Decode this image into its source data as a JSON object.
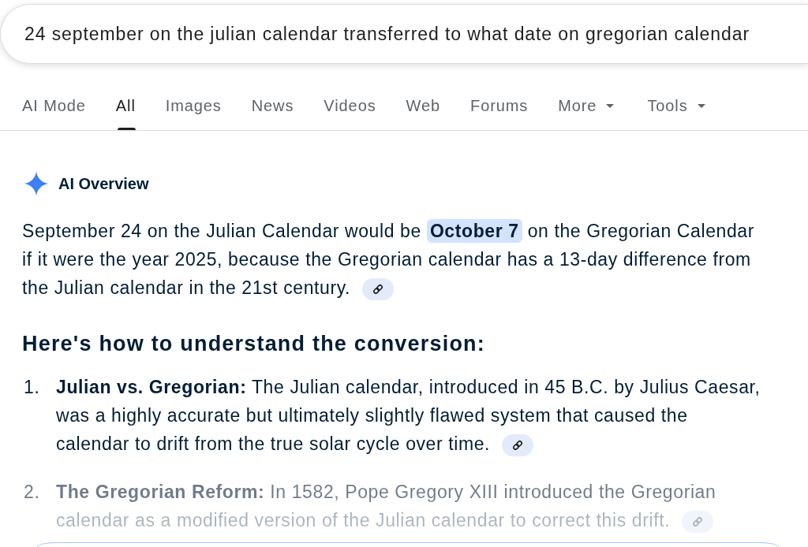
{
  "search": {
    "value": "24 september on the julian calendar transferred to what date on gregorian calendar"
  },
  "tabs": [
    {
      "label": "AI Mode",
      "selected": false,
      "dropdown": false
    },
    {
      "label": "All",
      "selected": true,
      "dropdown": false
    },
    {
      "label": "Images",
      "selected": false,
      "dropdown": false
    },
    {
      "label": "News",
      "selected": false,
      "dropdown": false
    },
    {
      "label": "Videos",
      "selected": false,
      "dropdown": false
    },
    {
      "label": "Web",
      "selected": false,
      "dropdown": false
    },
    {
      "label": "Forums",
      "selected": false,
      "dropdown": false
    },
    {
      "label": "More",
      "selected": false,
      "dropdown": true
    },
    {
      "label": "Tools",
      "selected": false,
      "dropdown": true
    }
  ],
  "ai_overview": {
    "title": "AI Overview",
    "summary": "September 24 on the Julian Calendar would be **October 7** on the Gregorian Calendar if it were the year 2025, because the Gregorian calendar has a 13-day difference from the Julian calendar in the 21st century.",
    "heading": "Here's how to understand the conversion:",
    "steps": [
      {
        "number": "1.",
        "text": "**Julian vs. Gregorian:** The Julian calendar, introduced in 45 B.C. by Julius Caesar, was a highly accurate but ultimately slightly flawed system that caused the calendar to drift from the true solar cycle over time."
      },
      {
        "number": "2.",
        "text": "**The Gregorian Reform:** In 1582, Pope Gregory XIII introduced the Gregorian calendar as a modified version of the Julian calendar to correct this drift."
      }
    ],
    "collapsed": true
  }
}
